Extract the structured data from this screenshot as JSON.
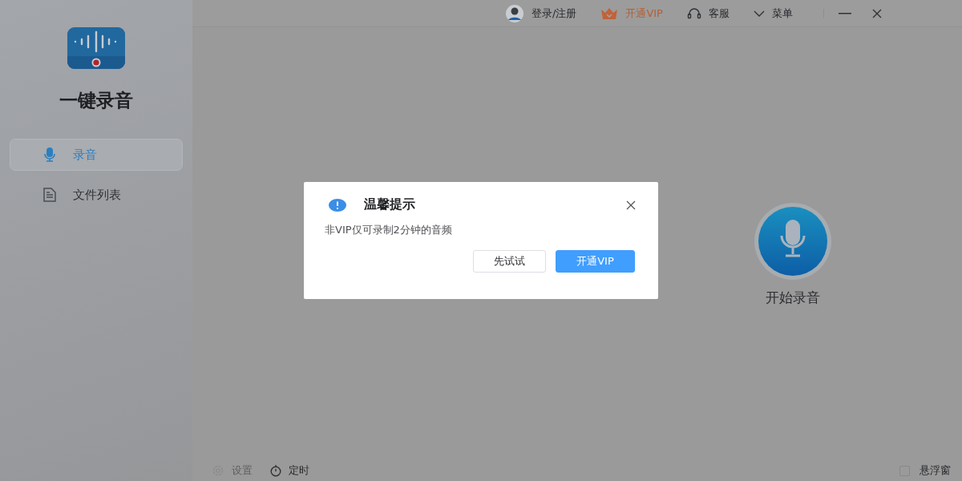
{
  "app": {
    "name": "一键录音"
  },
  "sidebar": {
    "items": [
      {
        "label": "录音",
        "kind": "mic",
        "selected": true
      },
      {
        "label": "文件列表",
        "kind": "file",
        "selected": false
      }
    ]
  },
  "topbar": {
    "items": [
      {
        "label": "登录/注册",
        "kind": "user"
      },
      {
        "label": "开通VIP",
        "kind": "vip"
      },
      {
        "label": "客服",
        "kind": "headset"
      },
      {
        "label": "菜单",
        "kind": "menu"
      }
    ]
  },
  "record_button": {
    "label": "开始录音"
  },
  "footer": {
    "items": [
      {
        "label": "设置",
        "kind": "settings",
        "disabled": true
      },
      {
        "label": "定时",
        "kind": "timer",
        "disabled": false
      }
    ],
    "float_window": {
      "label": "悬浮窗",
      "checked": false
    }
  },
  "dialog": {
    "title": "温馨提示",
    "message": "非VIP仅可录制2分钟的音频",
    "buttons": [
      {
        "label": "先试试",
        "kind": "secondary"
      },
      {
        "label": "开通VIP",
        "kind": "primary"
      }
    ]
  }
}
